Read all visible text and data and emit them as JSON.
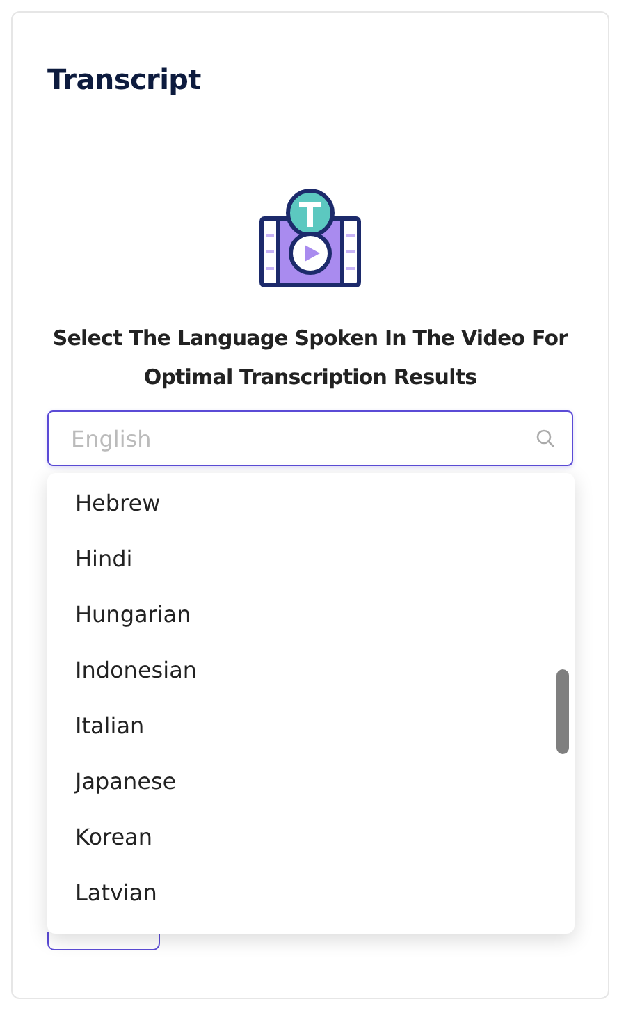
{
  "title": "Transcript",
  "prompt": "Select The Language Spoken In The Video For Optimal Transcription Results",
  "search": {
    "placeholder": "English"
  },
  "dropdown": {
    "expanded": true,
    "options": [
      {
        "label": "Hebrew",
        "selected": false
      },
      {
        "label": "Hindi",
        "selected": false
      },
      {
        "label": "Hungarian",
        "selected": false
      },
      {
        "label": "Indonesian",
        "selected": false
      },
      {
        "label": "Italian",
        "selected": false
      },
      {
        "label": "Japanese",
        "selected": false
      },
      {
        "label": "Korean",
        "selected": false
      },
      {
        "label": "Latvian",
        "selected": false
      }
    ]
  }
}
